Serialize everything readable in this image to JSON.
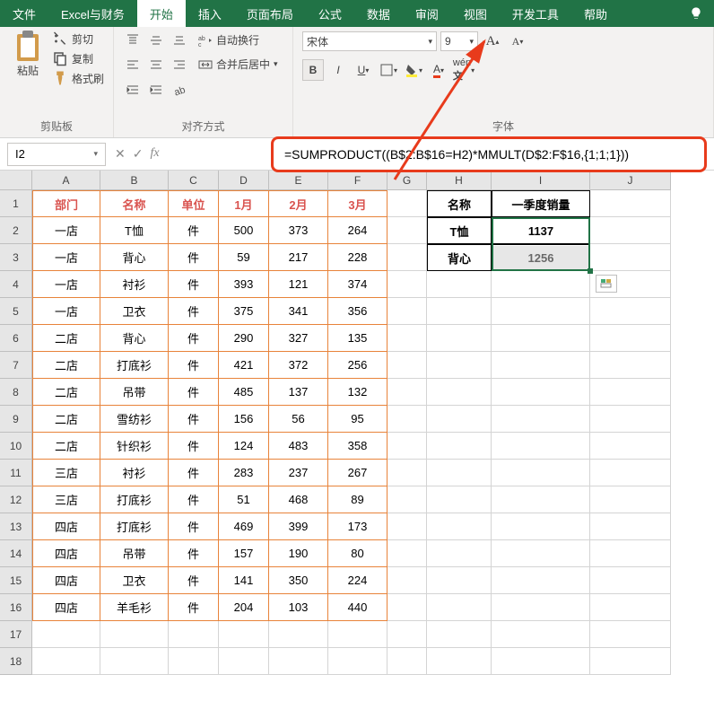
{
  "ribbon": {
    "tabs": [
      "文件",
      "Excel与财务",
      "开始",
      "插入",
      "页面布局",
      "公式",
      "数据",
      "审阅",
      "视图",
      "开发工具",
      "帮助"
    ],
    "active_tab": "开始",
    "clipboard": {
      "paste": "粘贴",
      "cut": "剪切",
      "copy": "复制",
      "format_painter": "格式刷",
      "group_label": "剪贴板"
    },
    "alignment": {
      "wrap_text": "自动换行",
      "merge_center": "合并后居中",
      "group_label": "对齐方式"
    },
    "font": {
      "name": "宋体",
      "size": "9",
      "group_label": "字体"
    }
  },
  "formula_bar": {
    "cell_ref": "I2",
    "formula": "=SUMPRODUCT((B$2:B$16=H2)*MMULT(D$2:F$16,{1;1;1}))"
  },
  "columns": [
    "A",
    "B",
    "C",
    "D",
    "E",
    "F",
    "G",
    "H",
    "I",
    "J"
  ],
  "rows": [
    "1",
    "2",
    "3",
    "4",
    "5",
    "6",
    "7",
    "8",
    "9",
    "10",
    "11",
    "12",
    "13",
    "14",
    "15",
    "16",
    "17",
    "18"
  ],
  "data_table": {
    "headers": [
      "部门",
      "名称",
      "单位",
      "1月",
      "2月",
      "3月"
    ],
    "rows": [
      [
        "一店",
        "T恤",
        "件",
        "500",
        "373",
        "264"
      ],
      [
        "一店",
        "背心",
        "件",
        "59",
        "217",
        "228"
      ],
      [
        "一店",
        "衬衫",
        "件",
        "393",
        "121",
        "374"
      ],
      [
        "一店",
        "卫衣",
        "件",
        "375",
        "341",
        "356"
      ],
      [
        "二店",
        "背心",
        "件",
        "290",
        "327",
        "135"
      ],
      [
        "二店",
        "打底衫",
        "件",
        "421",
        "372",
        "256"
      ],
      [
        "二店",
        "吊带",
        "件",
        "485",
        "137",
        "132"
      ],
      [
        "二店",
        "雪纺衫",
        "件",
        "156",
        "56",
        "95"
      ],
      [
        "二店",
        "针织衫",
        "件",
        "124",
        "483",
        "358"
      ],
      [
        "三店",
        "衬衫",
        "件",
        "283",
        "237",
        "267"
      ],
      [
        "三店",
        "打底衫",
        "件",
        "51",
        "468",
        "89"
      ],
      [
        "四店",
        "打底衫",
        "件",
        "469",
        "399",
        "173"
      ],
      [
        "四店",
        "吊带",
        "件",
        "157",
        "190",
        "80"
      ],
      [
        "四店",
        "卫衣",
        "件",
        "141",
        "350",
        "224"
      ],
      [
        "四店",
        "羊毛衫",
        "件",
        "204",
        "103",
        "440"
      ]
    ]
  },
  "summary_table": {
    "headers": [
      "名称",
      "一季度销量"
    ],
    "rows": [
      [
        "T恤",
        "1137"
      ],
      [
        "背心",
        "1256"
      ]
    ]
  },
  "chart_data": {
    "type": "table",
    "title": "一季度销量 by 名称 (SUMPRODUCT over months 1-3)",
    "categories": [
      "T恤",
      "背心"
    ],
    "values": [
      1137,
      1256
    ],
    "source_columns": [
      "1月",
      "2月",
      "3月"
    ]
  }
}
